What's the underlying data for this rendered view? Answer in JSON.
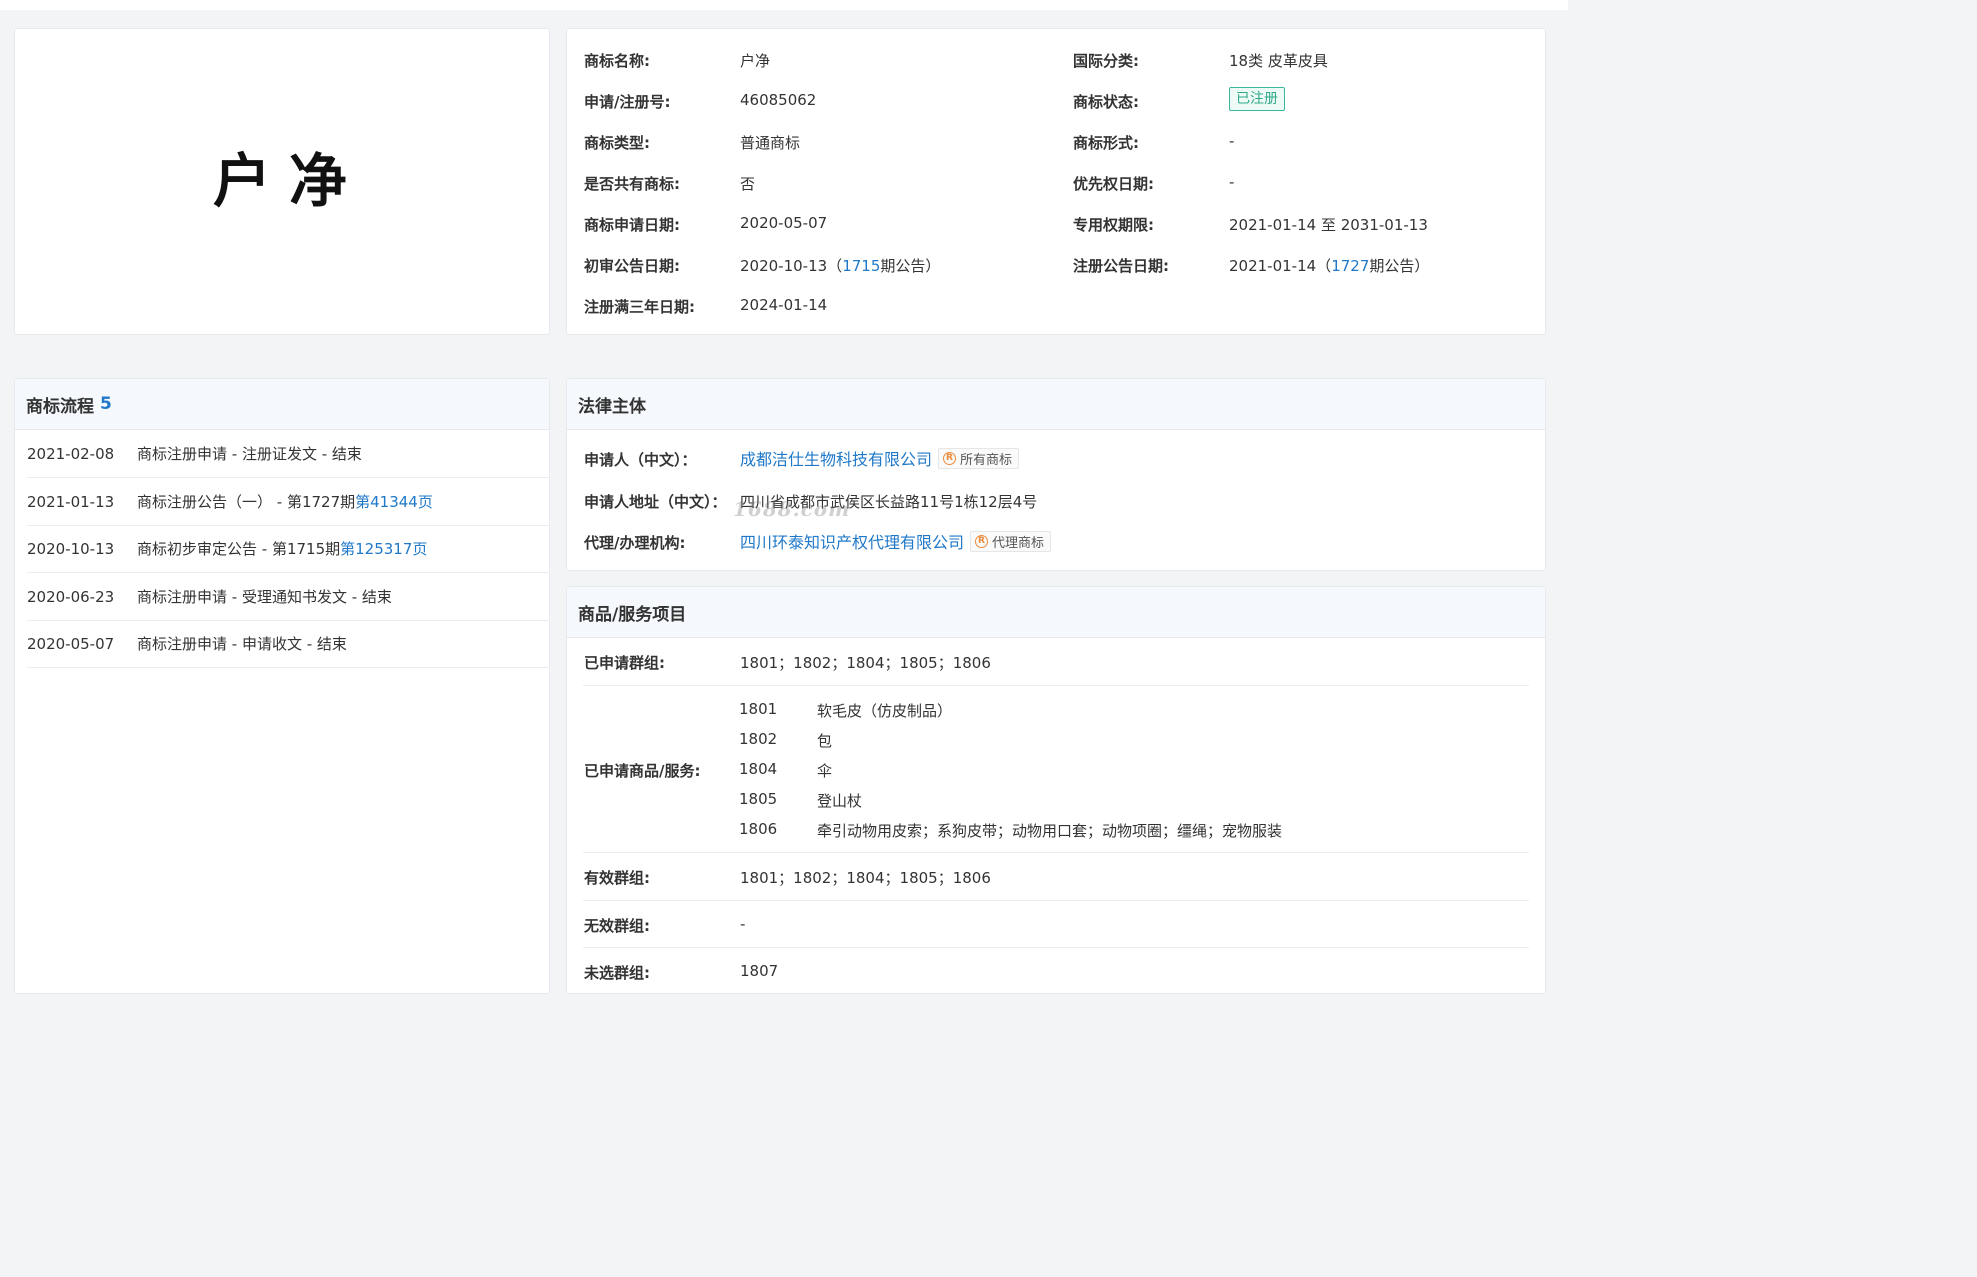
{
  "trademark": {
    "mark_text": "户净",
    "fields": {
      "name_label": "商标名称:",
      "name_value": "户净",
      "class_label": "国际分类:",
      "class_value": "18类 皮革皮具",
      "regno_label": "申请/注册号:",
      "regno_value": "46085062",
      "status_label": "商标状态:",
      "status_value": "已注册",
      "type_label": "商标类型:",
      "type_value": "普通商标",
      "form_label": "商标形式:",
      "form_value": "-",
      "shared_label": "是否共有商标:",
      "shared_value": "否",
      "priority_label": "优先权日期:",
      "priority_value": "-",
      "appdate_label": "商标申请日期:",
      "appdate_value": "2020-05-07",
      "exclusive_label": "专用权期限:",
      "exclusive_value": "2021-01-14 至 2031-01-13",
      "prelim_label": "初审公告日期:",
      "prelim_date": "2020-10-13（",
      "prelim_issue": "1715",
      "prelim_suffix": "期公告）",
      "regpub_label": "注册公告日期:",
      "regpub_date": "2021-01-14（",
      "regpub_issue": "1727",
      "regpub_suffix": "期公告）",
      "threeyear_label": "注册满三年日期:",
      "threeyear_value": "2024-01-14"
    }
  },
  "flow": {
    "title": "商标流程",
    "count": "5",
    "items": [
      {
        "date": "2021-02-08",
        "text": "商标注册申请 - 注册证发文 - 结束",
        "link": ""
      },
      {
        "date": "2021-01-13",
        "text": "商标注册公告（一） - 第1727期 ",
        "link": "第41344页"
      },
      {
        "date": "2020-10-13",
        "text": "商标初步审定公告 - 第1715期 ",
        "link": "第125317页"
      },
      {
        "date": "2020-06-23",
        "text": "商标注册申请 - 受理通知书发文 - 结束",
        "link": ""
      },
      {
        "date": "2020-05-07",
        "text": "商标注册申请 - 申请收文 - 结束",
        "link": ""
      }
    ]
  },
  "legal": {
    "title": "法律主体",
    "applicant_label": "申请人（中文）：",
    "applicant_value": "成都洁仕生物科技有限公司",
    "applicant_tag": "所有商标",
    "address_label": "申请人地址（中文）：",
    "address_value": "四川省成都市武侯区长益路11号1栋12层4号",
    "agent_label": "代理/办理机构:",
    "agent_value": "四川环泰知识产权代理有限公司",
    "agent_tag": "代理商标",
    "watermark": "1688.com"
  },
  "goods": {
    "title": "商品/服务项目",
    "applied_groups_label": "已申请群组:",
    "applied_groups_value": "1801；1802；1804；1805；1806",
    "applied_goods_label": "已申请商品/服务:",
    "goods_list": [
      {
        "code": "1801",
        "desc": "软毛皮（仿皮制品）"
      },
      {
        "code": "1802",
        "desc": "包"
      },
      {
        "code": "1804",
        "desc": "伞"
      },
      {
        "code": "1805",
        "desc": "登山杖"
      },
      {
        "code": "1806",
        "desc": "牵引动物用皮索；系狗皮带；动物用口套；动物项圈；缰绳；宠物服装"
      }
    ],
    "valid_groups_label": "有效群组:",
    "valid_groups_value": "1801；1802；1804；1805；1806",
    "invalid_groups_label": "无效群组:",
    "invalid_groups_value": "-",
    "unselected_groups_label": "未选群组:",
    "unselected_groups_value": "1807"
  }
}
